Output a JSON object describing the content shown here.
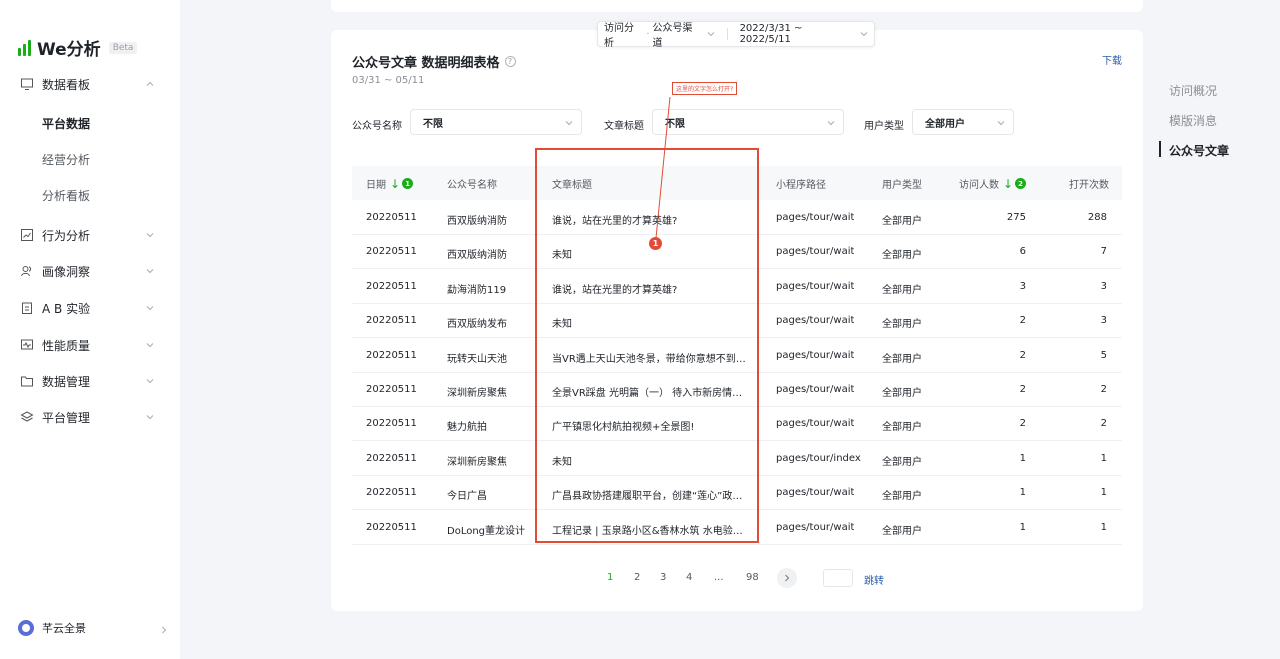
{
  "sidebar": {
    "logo_text": "We分析",
    "beta": "Beta",
    "groups": [
      {
        "label": "数据看板",
        "icon": "monitor-icon"
      },
      {
        "label": "行为分析",
        "icon": "trend-icon"
      },
      {
        "label": "画像洞察",
        "icon": "users-icon"
      },
      {
        "label": "A B 实验",
        "icon": "clipboard-icon"
      },
      {
        "label": "性能质量",
        "icon": "pulse-icon"
      },
      {
        "label": "数据管理",
        "icon": "folder-icon"
      },
      {
        "label": "平台管理",
        "icon": "layers-icon"
      }
    ],
    "sub_items": [
      "平台数据",
      "经营分析",
      "分析看板"
    ],
    "user": "芊云全景"
  },
  "filter_bar": {
    "analysis": "访问分析",
    "channel": "公众号渠道",
    "date_range": "2022/3/31 ~ 2022/5/11"
  },
  "card": {
    "title": "公众号文章 数据明细表格",
    "help": "?",
    "range": "03/31 ~ 05/11",
    "download": "下载",
    "filters": {
      "account_label": "公众号名称",
      "account_value": "不限",
      "article_label": "文章标题",
      "article_value": "不限",
      "usertype_label": "用户类型",
      "usertype_value": "全部用户"
    }
  },
  "annotation": {
    "note": "这里的文字怎么打开?",
    "marker": "1"
  },
  "table": {
    "headers": [
      "日期",
      "公众号名称",
      "文章标题",
      "小程序路径",
      "用户类型",
      "访问人数",
      "打开次数"
    ],
    "sort_badges": [
      "1",
      "2"
    ],
    "rows": [
      [
        "20220511",
        "西双版纳消防",
        "谁说，站在光里的才算英雄?",
        "pages/tour/wait",
        "全部用户",
        "275",
        "288"
      ],
      [
        "20220511",
        "西双版纳消防",
        "未知",
        "pages/tour/wait",
        "全部用户",
        "6",
        "7"
      ],
      [
        "20220511",
        "勐海消防119",
        "谁说，站在光里的才算英雄?",
        "pages/tour/wait",
        "全部用户",
        "3",
        "3"
      ],
      [
        "20220511",
        "西双版纳发布",
        "未知",
        "pages/tour/wait",
        "全部用户",
        "2",
        "3"
      ],
      [
        "20220511",
        "玩转天山天池",
        "当VR遇上天山天池冬景，带给你意想不到的...",
        "pages/tour/wait",
        "全部用户",
        "2",
        "5"
      ],
      [
        "20220511",
        "深圳新房聚焦",
        "全景VR踩盘 光明篇（一） 待入市新房情况及...",
        "pages/tour/wait",
        "全部用户",
        "2",
        "2"
      ],
      [
        "20220511",
        "魅力航拍",
        "广平镇思化村航拍视频+全景图!",
        "pages/tour/wait",
        "全部用户",
        "2",
        "2"
      ],
      [
        "20220511",
        "深圳新房聚焦",
        "未知",
        "pages/tour/index",
        "全部用户",
        "1",
        "1"
      ],
      [
        "20220511",
        "今日广昌",
        "广昌县政协搭建履职平台，创建“莲心”政协品...",
        "pages/tour/wait",
        "全部用户",
        "1",
        "1"
      ],
      [
        "20220511",
        "DoLong董龙设计",
        "工程记录 | 玉泉路小区&香林水筑 水电验收（...",
        "pages/tour/wait",
        "全部用户",
        "1",
        "1"
      ]
    ]
  },
  "pagination": {
    "pages": [
      "1",
      "2",
      "3",
      "4",
      "...",
      "98"
    ],
    "current": "1",
    "jump": "跳转"
  },
  "right_nav": [
    "访问概况",
    "模版消息",
    "公众号文章"
  ],
  "colors": {
    "accent": "#1aad19",
    "annotation": "#e24b35",
    "link": "#2a5caa"
  }
}
